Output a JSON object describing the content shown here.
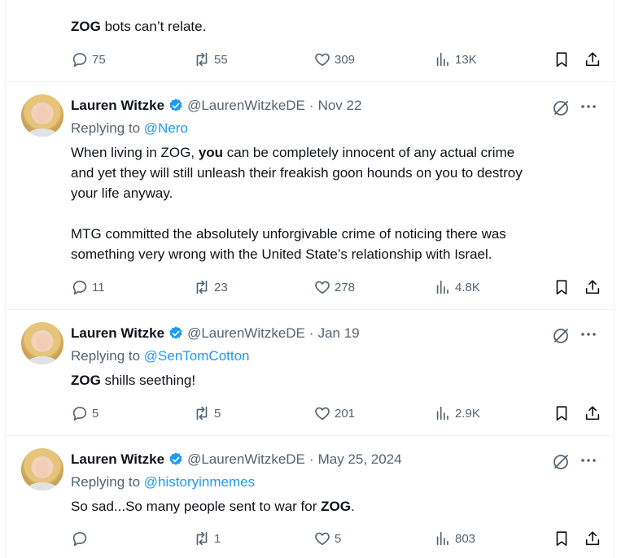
{
  "tweet0": {
    "text_bold": "ZOG",
    "text_rest": " bots can’t relate.",
    "replies": "75",
    "reposts": "55",
    "likes": "309",
    "views": "13K"
  },
  "tweet1": {
    "name": "Lauren Witzke",
    "handle": "@LaurenWitzkeDE",
    "separator": "·",
    "date": "Nov 22",
    "replying_prefix": "Replying to",
    "replying_to": "@Nero",
    "line1_a": "When living in ZOG, ",
    "line1_b": "you",
    "line1_c": " can be completely innocent of any actual crime",
    "line2": "and yet they will still unleash their freakish goon hounds on you to destroy",
    "line3": "your life anyway.",
    "line4": "MTG committed the absolutely unforgivable crime of noticing there was",
    "line5": "something very wrong with the United State’s relationship with Israel.",
    "replies": "11",
    "reposts": "23",
    "likes": "278",
    "views": "4.8K"
  },
  "tweet2": {
    "name": "Lauren Witzke",
    "handle": "@LaurenWitzkeDE",
    "separator": "·",
    "date": "Jan 19",
    "replying_prefix": "Replying to",
    "replying_to": "@SenTomCotton",
    "text_bold": "ZOG",
    "text_rest": " shills seething!",
    "replies": "5",
    "reposts": "5",
    "likes": "201",
    "views": "2.9K"
  },
  "tweet3": {
    "name": "Lauren Witzke",
    "handle": "@LaurenWitzkeDE",
    "separator": "·",
    "date": "May 25, 2024",
    "replying_prefix": "Replying to",
    "replying_to": "@historyinmemes",
    "text_a": "So sad...So many people sent to war for ",
    "text_bold": "ZOG",
    "text_c": ".",
    "replies": "",
    "reposts": "1",
    "likes": "5",
    "views": "803"
  },
  "icons": {
    "reply": "reply-icon",
    "repost": "repost-icon",
    "like": "heart-icon",
    "views": "views-icon",
    "bookmark": "bookmark-icon",
    "share": "share-icon",
    "grok": "grok-icon",
    "more": "more-icon",
    "verified": "verified-badge-icon"
  },
  "colors": {
    "accent": "#1d9bf0",
    "text": "#0f1419",
    "muted": "#536471",
    "border": "#eff3f4"
  }
}
